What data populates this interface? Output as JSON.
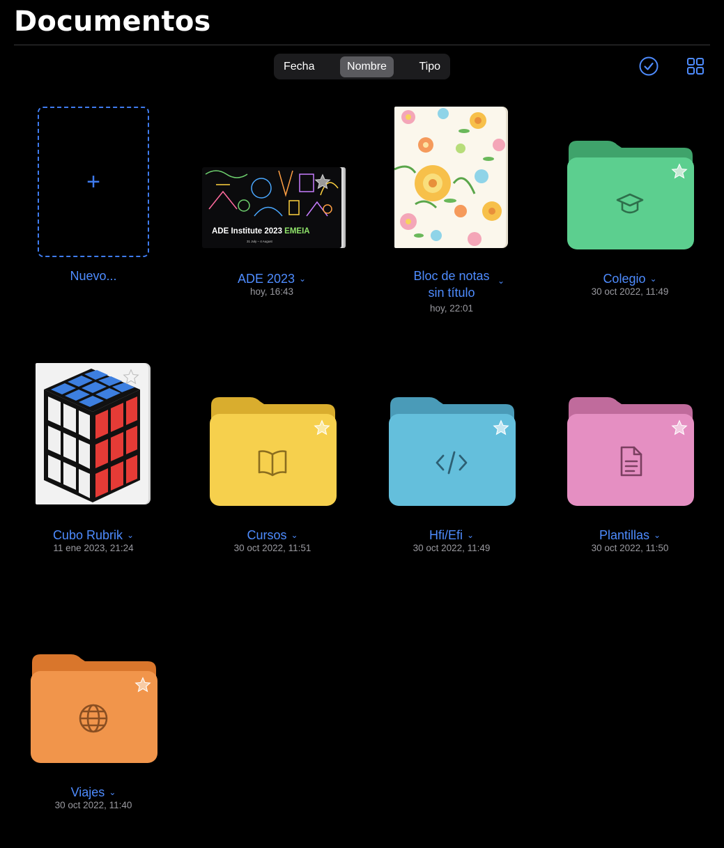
{
  "page": {
    "title": "Documentos"
  },
  "sort": {
    "options": [
      "Fecha",
      "Nombre",
      "Tipo"
    ],
    "selected": "Nombre"
  },
  "header_icons": {
    "select": "checkmark-circle-icon",
    "view": "grid-icon"
  },
  "new_item": {
    "label": "Nuevo..."
  },
  "items": [
    {
      "name": "ADE 2023",
      "date": "hoy, 16:43",
      "kind": "document",
      "cover": {
        "title_part1": "ADE Institute 2023 ",
        "title_part2": "EMEIA",
        "subtitle": "31 July – 4 August"
      }
    },
    {
      "name_line1": "Bloc de notas",
      "name_line2": "sin título",
      "date": "hoy, 22:01",
      "kind": "notebook"
    },
    {
      "name": "Colegio",
      "date": "30 oct 2022, 11:49",
      "kind": "folder",
      "color": "#5ccf8f",
      "icon": "graduation-cap-icon"
    },
    {
      "name": "Cubo Rubrik",
      "date": "11 ene 2023, 21:24",
      "kind": "document"
    },
    {
      "name": "Cursos",
      "date": "30 oct 2022, 11:51",
      "kind": "folder",
      "color": "#f6d04d",
      "icon": "book-icon"
    },
    {
      "name": "Hfi/Efi",
      "date": "30 oct 2022, 11:49",
      "kind": "folder",
      "color": "#64bfdc",
      "icon": "code-icon"
    },
    {
      "name": "Plantillas",
      "date": "30 oct 2022, 11:50",
      "kind": "folder",
      "color": "#e58fc2",
      "icon": "document-icon"
    },
    {
      "name": "Viajes",
      "date": "30 oct 2022, 11:40",
      "kind": "folder",
      "color": "#f1954b",
      "icon": "globe-icon"
    }
  ],
  "colors": {
    "accent": "#4e8cff",
    "background": "#000000"
  }
}
